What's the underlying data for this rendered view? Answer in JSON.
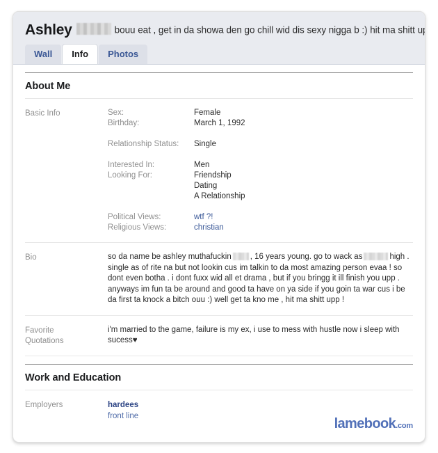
{
  "profile": {
    "name": "Ashley",
    "name_redacted": true,
    "status": "bouu eat , get in da showa den go chill wid dis sexy nigga b :) hit ma shitt uppp !"
  },
  "tabs": [
    {
      "label": "Wall",
      "active": false
    },
    {
      "label": "Info",
      "active": true
    },
    {
      "label": "Photos",
      "active": false
    }
  ],
  "sections": {
    "about_me": {
      "heading": "About Me",
      "basic_info": {
        "label": "Basic Info",
        "fields": [
          {
            "key": "Sex:",
            "value": "Female"
          },
          {
            "key": "Birthday:",
            "value": "March 1, 1992"
          },
          {
            "key": "Relationship Status:",
            "value": "Single"
          },
          {
            "key": "Interested In:",
            "value": "Men"
          },
          {
            "key": "Looking For:",
            "value": "Friendship"
          },
          {
            "key": "",
            "value": "Dating"
          },
          {
            "key": "",
            "value": "A Relationship"
          },
          {
            "key": "Political Views:",
            "value": "wtf ?!",
            "is_link": true
          },
          {
            "key": "Religious Views:",
            "value": "christian",
            "is_link": true
          }
        ]
      },
      "bio": {
        "label": "Bio",
        "part1": "so da name be ashley muthafuckin",
        "part2": ", 16 years young. go to wack as",
        "part3": "high . single as of rite na but not lookin cus im talkin to da most amazing person evaa ! so dont even botha . i dont fuxx wid all et drama , but if you bringg it ill finish you upp . anyways im fun ta be around and good ta have on ya side if you goin ta war cus i be da first ta knock a bitch ouu :) well get ta kno me , hit ma shitt upp !"
      },
      "favorite_quotations": {
        "label": "Favorite Quotations",
        "label_line1": "Favorite",
        "label_line2": "Quotations",
        "value": "i'm married to the game, failure is my ex, i use to mess with hustle now i sleep with sucess",
        "heart": "♥"
      }
    },
    "work_and_education": {
      "heading": "Work and Education",
      "employers": {
        "label": "Employers",
        "name": "hardees",
        "role": "front line"
      }
    }
  },
  "watermark": {
    "main": "lamebook",
    "tld": ".com"
  },
  "colors": {
    "tab_link": "#3a5795",
    "header_bg": "#e9ebf0",
    "link": "#3b5998",
    "watermark": "#5170b8",
    "label_grey": "#8f8f8f"
  }
}
